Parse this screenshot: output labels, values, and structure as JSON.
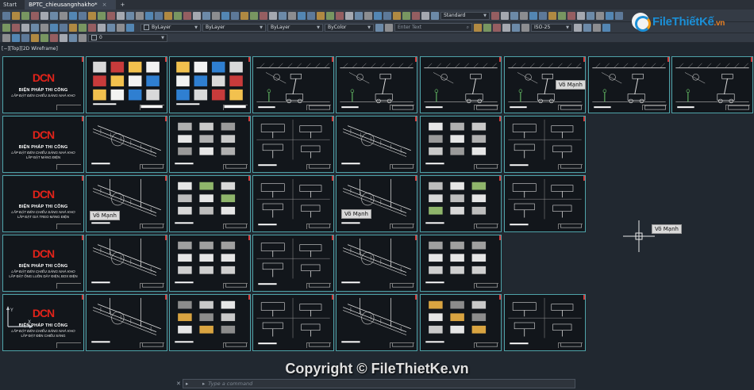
{
  "tabs": [
    {
      "label": "Start"
    },
    {
      "label": "BPTC_chieusangnhakho*"
    }
  ],
  "toolbar": {
    "textstyle": "Standard",
    "layer": "0",
    "color": "ByLayer",
    "linetype": "ByLayer",
    "lineweight": "ByLayer",
    "plotstyle": "ByColor",
    "search_placeholder": "Enter Text",
    "dimstyle": "ISO-25"
  },
  "logo": {
    "text": "FileThiếtKế",
    "domain": ".vn"
  },
  "viewport": {
    "label": "[−][Top][2D Wireframe]",
    "tag": "Võ Mạnh"
  },
  "title_sheets": [
    {
      "brand": "DCN",
      "title": "BIỆN PHÁP THI CÔNG",
      "sub": "LẮP ĐẶT ĐÈN CHIẾU SÁNG NHÀ KHO",
      "sub2": ""
    },
    {
      "brand": "DCN",
      "title": "BIỆN PHÁP THI CÔNG",
      "sub": "LẮP ĐẶT ĐÈN CHIẾU SÁNG NHÀ KHO",
      "sub2": "LẮP ĐẶT MÁNG ĐIỆN"
    },
    {
      "brand": "DCN",
      "title": "BIỆN PHÁP THI CÔNG",
      "sub": "LẮP ĐẶT ĐÈN CHIẾU SÁNG NHÀ KHO",
      "sub2": "LẮP ĐẶT GIÁ TREO MÁNG ĐIỆN"
    },
    {
      "brand": "DCN",
      "title": "BIỆN PHÁP THI CÔNG",
      "sub": "LẮP ĐẶT ĐÈN CHIẾU SÁNG NHÀ KHO",
      "sub2": "LẮP ĐẶT ỐNG LUỒN DÂY ĐIỆN, BOX ĐIỆN"
    },
    {
      "brand": "DCN",
      "title": "BIỆN PHÁP THI CÔNG",
      "sub": "LẮP ĐẶT ĐÈN CHIẾU SÁNG NHÀ KHO",
      "sub2": "LẮP ĐẶT ĐÈN CHIẾU SÁNG"
    }
  ],
  "copyright": "Copyright © FileThietKe.vn",
  "command": {
    "placeholder": "Type a command"
  },
  "colors": {
    "frame": "#4fa3a9",
    "background": "#212830",
    "brand_red": "#e2231a"
  }
}
